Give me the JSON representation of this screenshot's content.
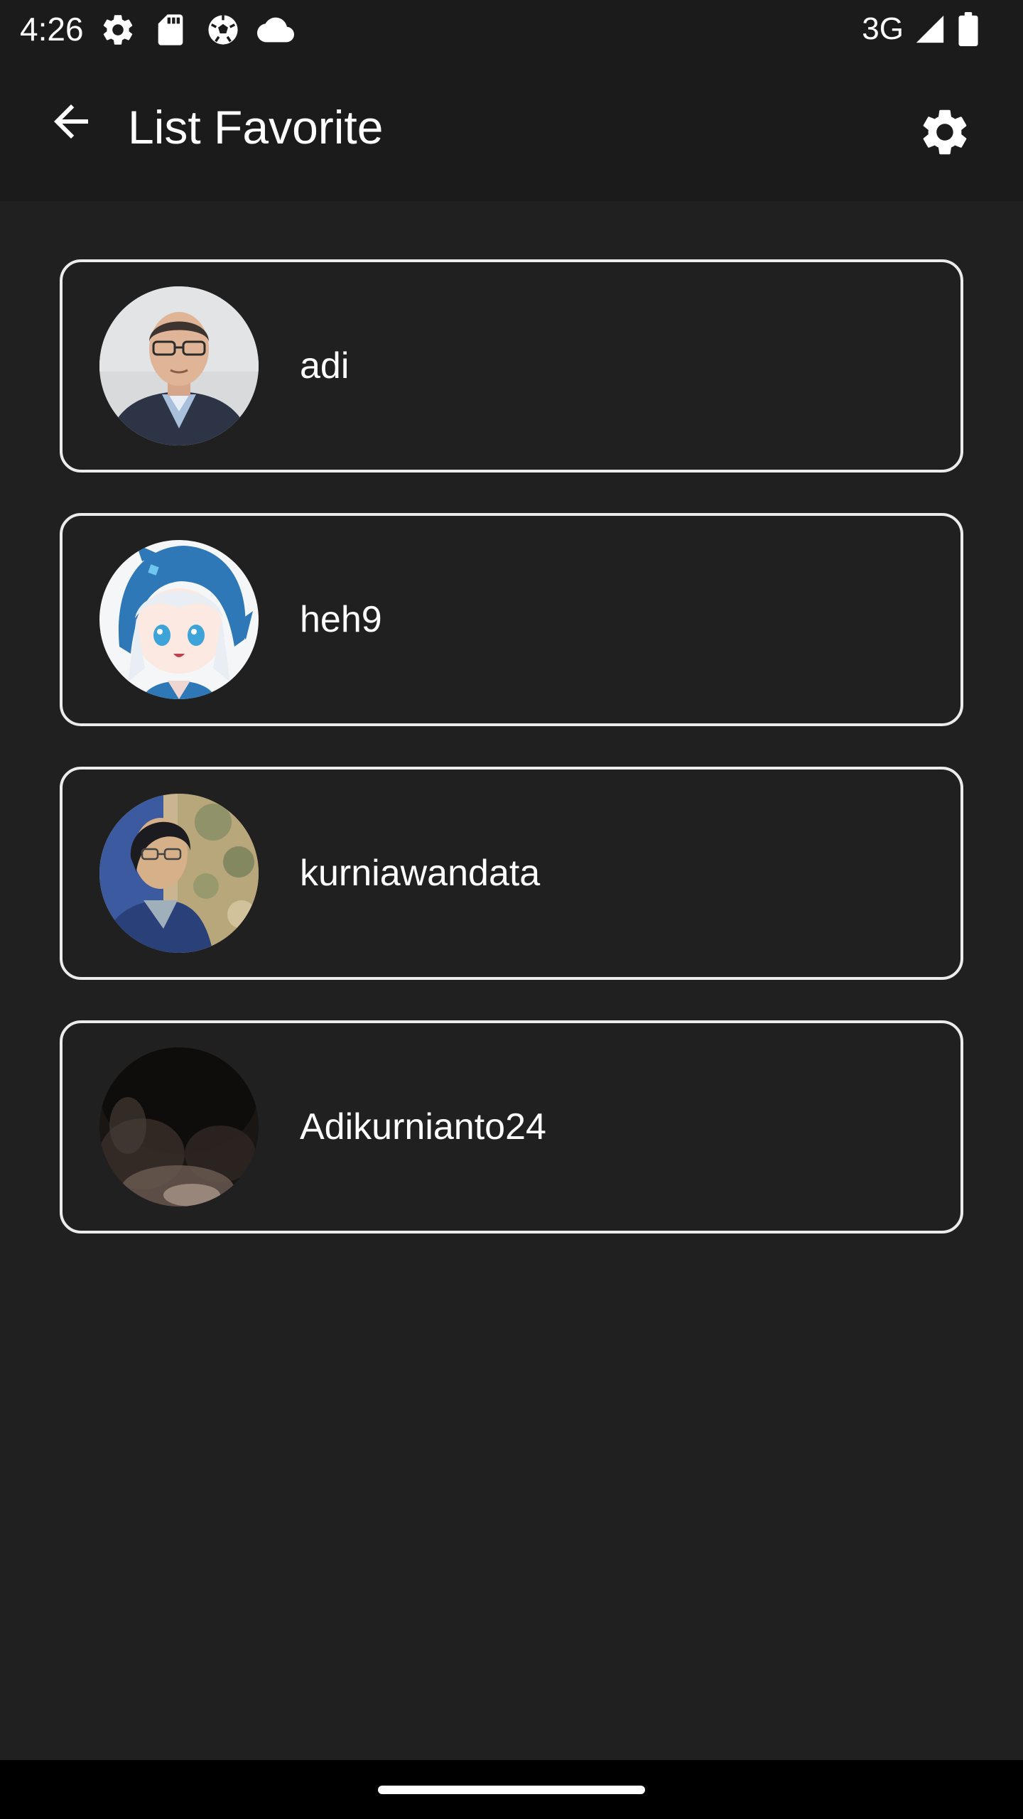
{
  "status_bar": {
    "time": "4:26",
    "network": "3G",
    "left_icons": [
      "gear-icon",
      "sd-card-icon",
      "soccer-ball-icon",
      "cloud-icon"
    ],
    "right_icons": [
      "signal-icon",
      "battery-icon"
    ]
  },
  "app_bar": {
    "title": "List Favorite",
    "back_icon": "arrow-left-icon",
    "settings_icon": "gear-icon"
  },
  "favorites": [
    {
      "name": "adi",
      "avatar": "photo-man-with-glasses"
    },
    {
      "name": "heh9",
      "avatar": "anime-character-shark-hood"
    },
    {
      "name": "kurniawandata",
      "avatar": "photo-man-with-glasses-outdoor"
    },
    {
      "name": "Adikurnianto24",
      "avatar": "blurred-dark-photo"
    }
  ],
  "colors": {
    "background": "#202020",
    "bars": "#1b1b1b",
    "card_border": "#ececec",
    "text": "#ffffff"
  }
}
